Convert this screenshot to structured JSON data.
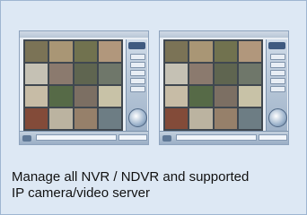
{
  "screenshots": [
    {
      "alt_name": "nvr-software-screenshot-1",
      "grid_cells": 16,
      "accent": "#3f5a80"
    },
    {
      "alt_name": "nvr-software-screenshot-2",
      "grid_cells": 16,
      "accent": "#3f5a80"
    }
  ],
  "caption": {
    "line1": "Manage all NVR / NDVR and supported",
    "line2": "IP camera/video server"
  },
  "colors": {
    "background": "#dde8f4",
    "border": "#9fb6d1",
    "text": "#111111"
  }
}
